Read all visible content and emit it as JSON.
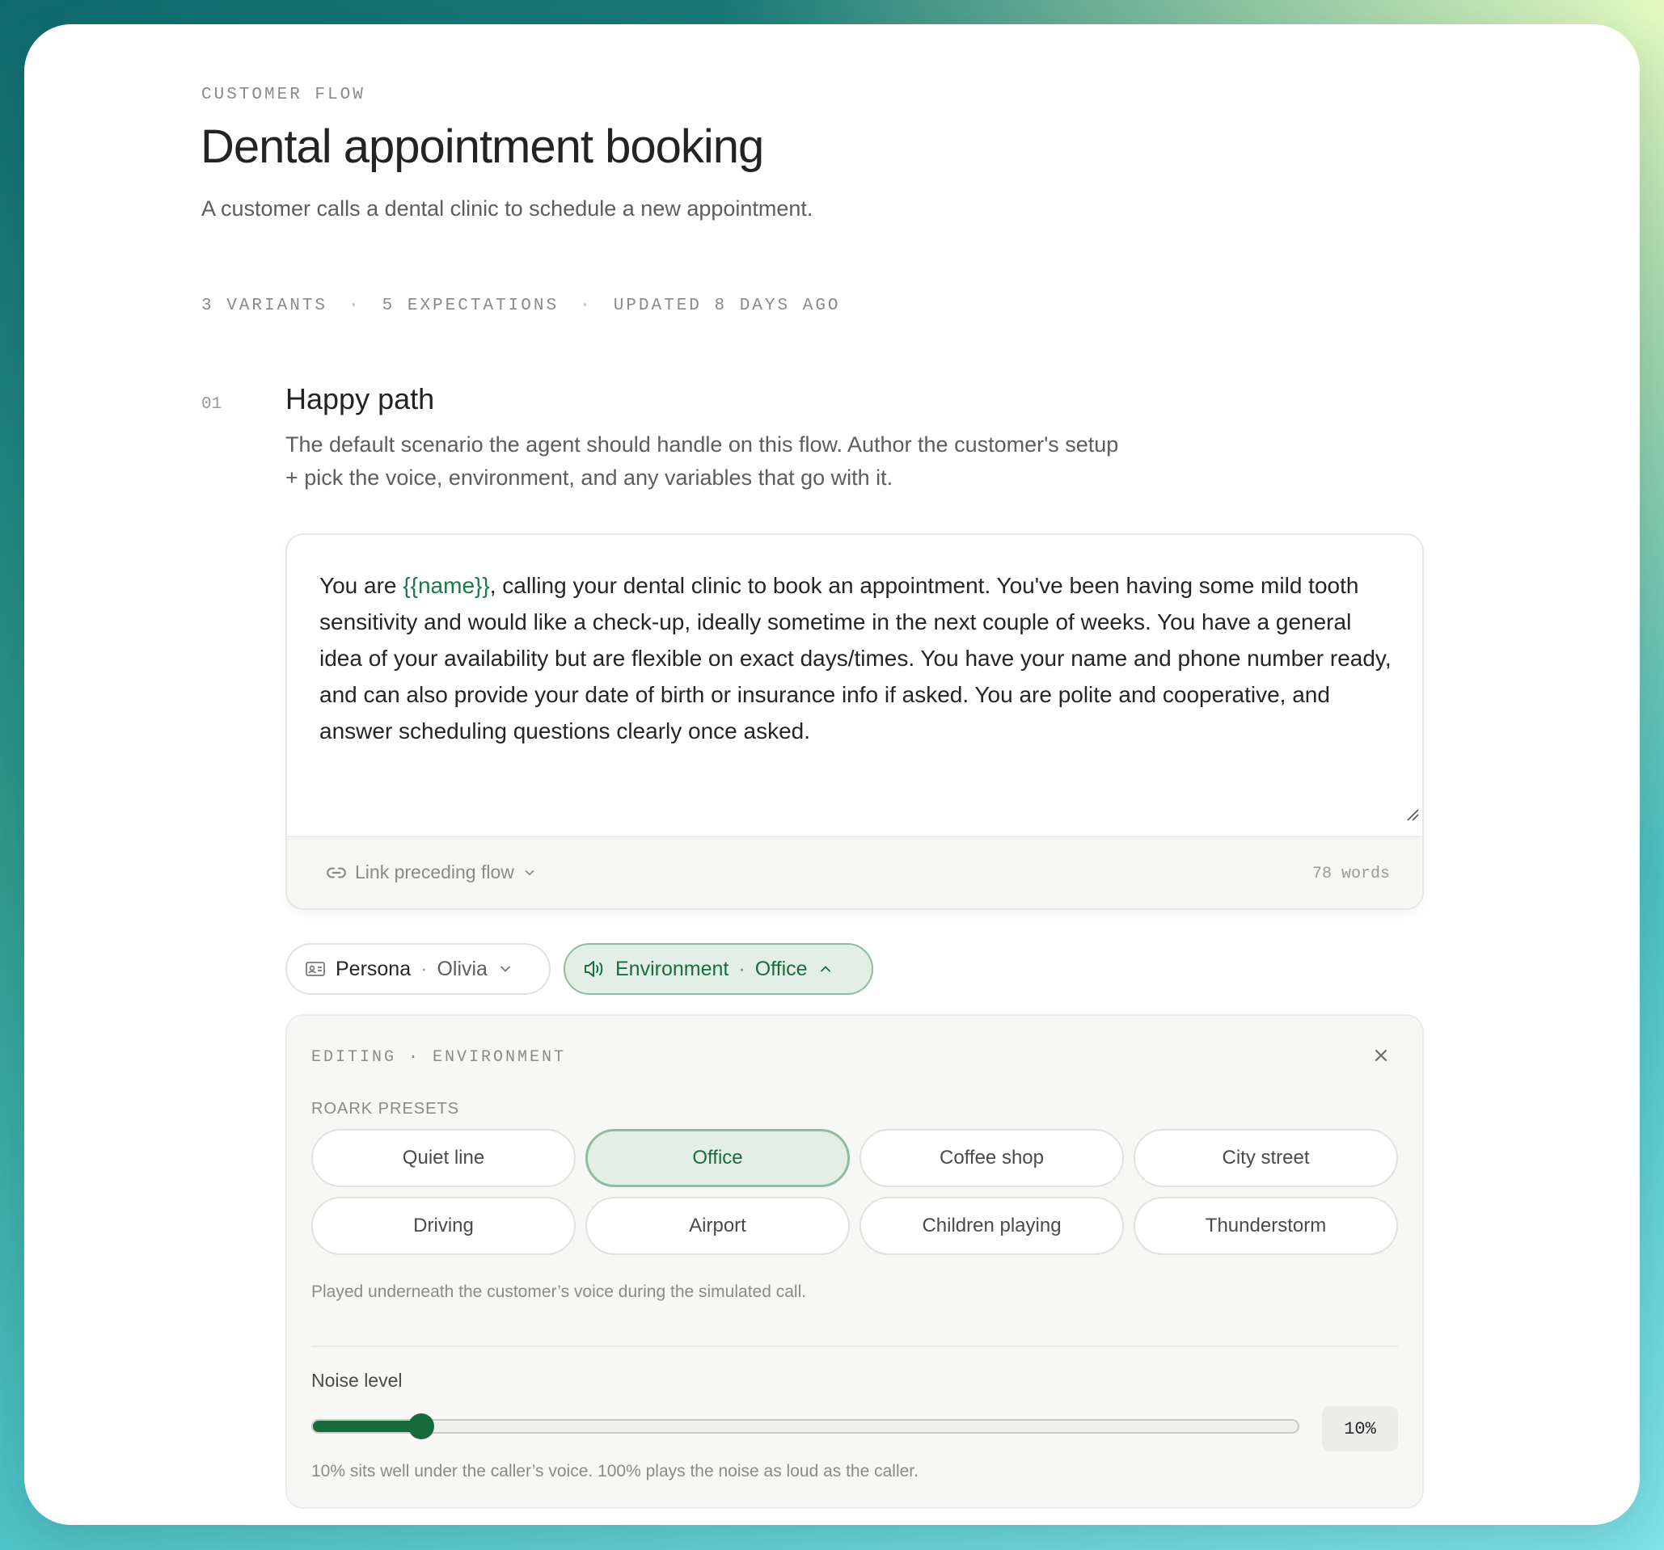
{
  "header": {
    "eyebrow": "CUSTOMER FLOW",
    "title": "Dental appointment booking",
    "subtitle": "A customer calls a dental clinic to schedule a new appointment.",
    "meta": [
      "3 VARIANTS",
      "5 EXPECTATIONS",
      "UPDATED 8 DAYS AGO"
    ],
    "meta_separator": "·"
  },
  "section": {
    "number": "01",
    "title": "Happy path",
    "description_line1": "The default scenario the agent should handle on this flow. Author the customer's setup",
    "description_line2": "+ pick the voice, environment, and any variables that go with it."
  },
  "editor": {
    "text_before": "You are ",
    "variable": "{{name}}",
    "text_after": ", calling your dental clinic to book an appointment. You've been having some mild tooth sensitivity and would like a check-up, ideally sometime in the next couple of weeks. You have a general idea of your availability but are flexible on exact days/times. You have your name and phone number ready, and can also provide your date of birth or insurance info if asked. You are polite and cooperative, and answer scheduling questions clearly once asked.",
    "link_flow_label": "Link preceding flow",
    "word_count": "78 words"
  },
  "chips": {
    "persona": {
      "label": "Persona",
      "sep": "·",
      "value": "Olivia",
      "icon": "id-card-icon"
    },
    "environment": {
      "label": "Environment",
      "sep": "·",
      "value": "Office",
      "icon": "speaker-icon"
    }
  },
  "panel": {
    "label": "EDITING · ENVIRONMENT",
    "presets_label": "ROARK PRESETS",
    "presets": [
      "Quiet line",
      "Office",
      "Coffee shop",
      "City street",
      "Driving",
      "Airport",
      "Children playing",
      "Thunderstorm"
    ],
    "selected_preset": "Office",
    "note": "Played underneath the customer’s voice during the simulated call.",
    "noise_label": "Noise level",
    "noise_level": 0.1,
    "noise_value_text": "10%",
    "noise_note": "10% sits well under the caller’s voice. 100% plays the noise as loud as the caller."
  },
  "colors": {
    "accent": "#176a3c",
    "accent_bg": "#e3efe5",
    "variable": "#1a7a45"
  }
}
